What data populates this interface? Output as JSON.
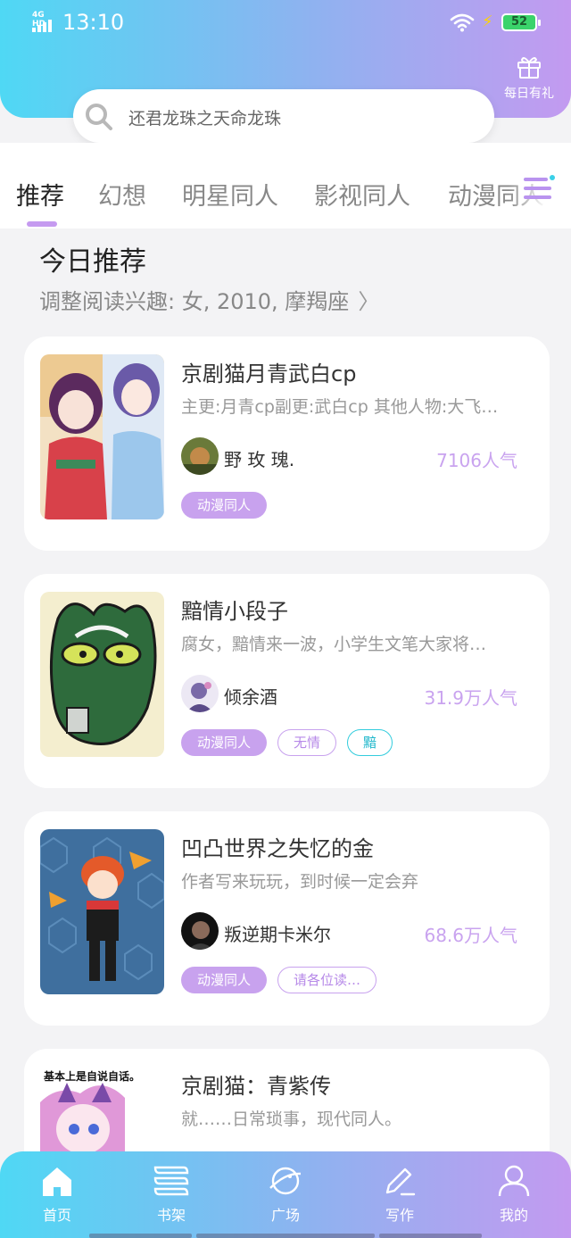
{
  "colors": {
    "accent": "#c8a2ee",
    "gradient_start": "#4fd8f4",
    "gradient_end": "#c39af0",
    "tag_cyan": "#33ccdd"
  },
  "status_bar": {
    "network": "4G HD",
    "time": "13:10",
    "battery": "52"
  },
  "header": {
    "gift_label": "每日有礼",
    "gift_icon": "gift-icon"
  },
  "search": {
    "placeholder": "还君龙珠之天命龙珠",
    "icon": "search-icon"
  },
  "tabs": [
    {
      "label": "推荐",
      "active": true
    },
    {
      "label": "幻想"
    },
    {
      "label": "明星同人"
    },
    {
      "label": "影视同人"
    },
    {
      "label": "动漫同人"
    }
  ],
  "section": {
    "title": "今日推荐",
    "interest": "调整阅读兴趣: 女, 2010, 摩羯座",
    "interest_arrow": "〉"
  },
  "books": [
    {
      "title": "京剧猫月青武白cp",
      "desc": "主更:月青cp副更:武白cp 其他人物:大飞…",
      "author": "野 玫 瑰.",
      "popularity": "7106人气",
      "tags": [
        {
          "label": "动漫同人",
          "style": "filled"
        }
      ]
    },
    {
      "title": "黯情小段子",
      "desc": "腐女，黯情来一波，小学生文笔大家将…",
      "author": "倾余酒",
      "popularity": "31.9万人气",
      "tags": [
        {
          "label": "动漫同人",
          "style": "filled"
        },
        {
          "label": "无情",
          "style": "outline"
        },
        {
          "label": "黯",
          "style": "cyan"
        }
      ]
    },
    {
      "title": "凹凸世界之失忆的金",
      "desc": "作者写来玩玩，到时候一定会弃",
      "author": "叛逆期卡米尔",
      "popularity": "68.6万人气",
      "tags": [
        {
          "label": "动漫同人",
          "style": "filled"
        },
        {
          "label": "请各位读…",
          "style": "outline"
        }
      ]
    },
    {
      "title": "京剧猫：青紫传",
      "desc": "就……日常琐事，现代同人。",
      "cover_text": "基本上是自说自话。"
    }
  ],
  "bottom_nav": [
    {
      "label": "首页",
      "icon": "home-icon",
      "active": true
    },
    {
      "label": "书架",
      "icon": "bookshelf-icon"
    },
    {
      "label": "广场",
      "icon": "planet-icon"
    },
    {
      "label": "写作",
      "icon": "pen-icon"
    },
    {
      "label": "我的",
      "icon": "user-icon"
    }
  ]
}
